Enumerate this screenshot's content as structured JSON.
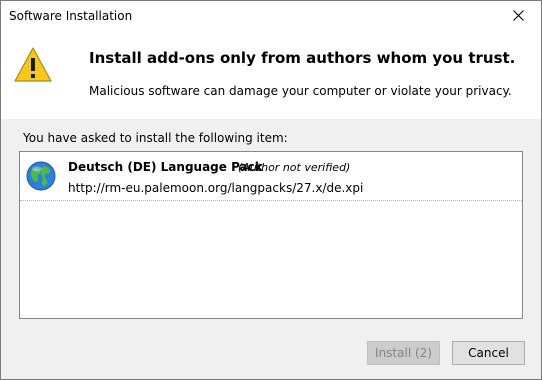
{
  "window": {
    "title": "Software Installation",
    "close_icon": "close-icon"
  },
  "header": {
    "icon": "warning-icon",
    "heading": "Install add-ons only from authors whom you trust.",
    "subtext": "Malicious software can damage your computer or violate your privacy."
  },
  "main": {
    "prompt": "You have asked to install the following item:",
    "items": [
      {
        "icon": "globe-icon",
        "name": "Deutsch (DE) Language Pack",
        "author_status": "(Author not verified)",
        "url": "http://rm-eu.palemoon.org/langpacks/27.x/de.xpi"
      }
    ]
  },
  "buttons": {
    "install_label": "Install (2)",
    "install_enabled": false,
    "cancel_label": "Cancel"
  },
  "colors": {
    "warning_yellow": "#f7c71b",
    "disabled_text": "#838383",
    "button_face": "#e1e1e1"
  }
}
